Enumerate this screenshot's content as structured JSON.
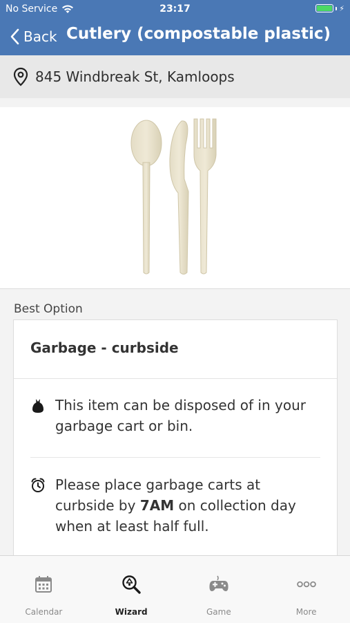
{
  "status_bar": {
    "carrier": "No Service",
    "time": "23:17"
  },
  "nav": {
    "back_label": "Back",
    "title": "Cutlery (compostable plastic)"
  },
  "address": {
    "text": "845 Windbreak St, Kamloops"
  },
  "best_option": {
    "section_label": "Best Option",
    "title": "Garbage - curbside",
    "items": [
      {
        "icon": "garbage-bag-icon",
        "text": "This item can be disposed of in your garbage cart or bin."
      },
      {
        "icon": "alarm-clock-icon",
        "text_before": "Please place garbage carts at curbside by ",
        "emphasis": "7AM",
        "text_after": " on collection day when at least half full."
      }
    ]
  },
  "tabbar": {
    "tabs": [
      {
        "label": "Calendar",
        "icon": "calendar-icon",
        "active": false
      },
      {
        "label": "Wizard",
        "icon": "search-recycle-icon",
        "active": true
      },
      {
        "label": "Game",
        "icon": "gamepad-icon",
        "active": false
      },
      {
        "label": "More",
        "icon": "more-icon",
        "active": false
      }
    ]
  },
  "colors": {
    "header": "#4a78b5",
    "battery": "#4cd964",
    "background": "#f3f3f3"
  }
}
